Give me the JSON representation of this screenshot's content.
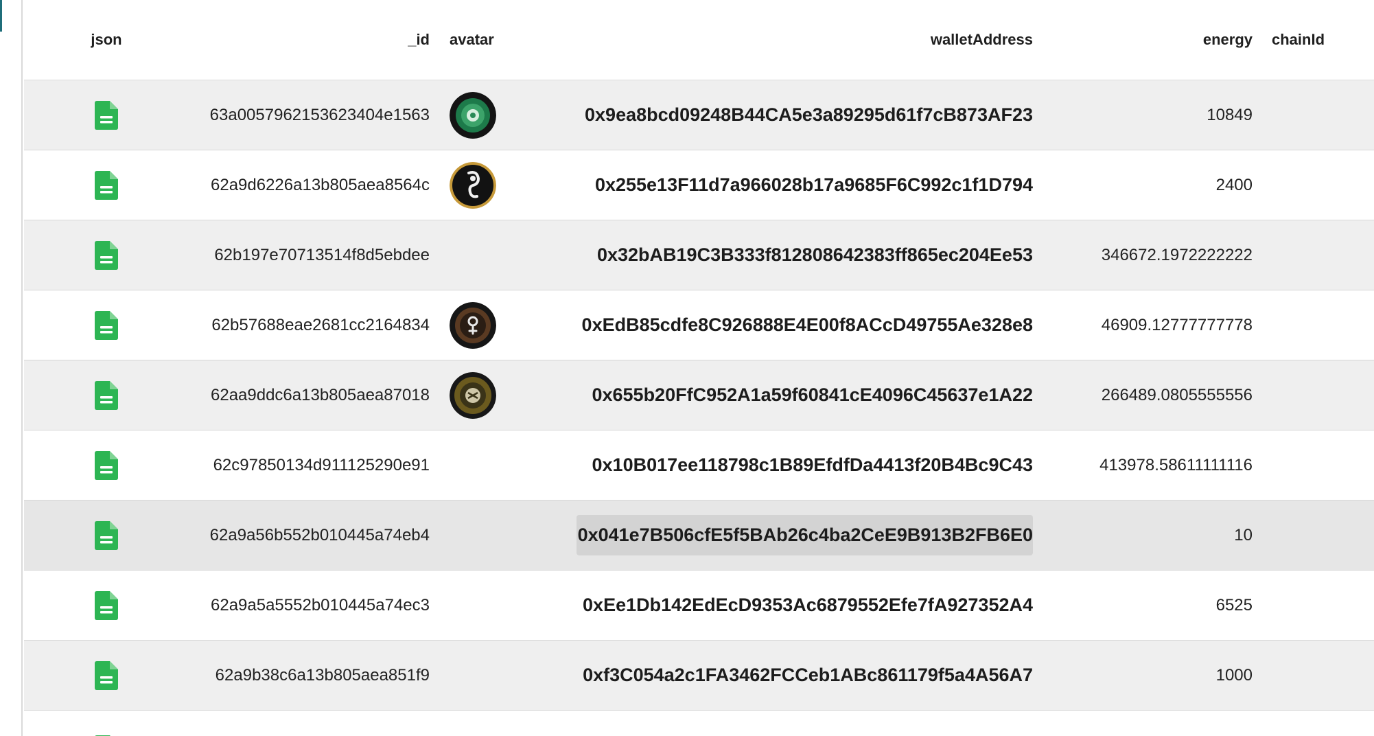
{
  "colors": {
    "accent": "#1f6e7a",
    "json_icon": "#2db553",
    "row_striped": "#efefef",
    "row_plain": "#ffffff",
    "selected_cell": "#d3d3d3"
  },
  "columns": {
    "json": "json",
    "id": "_id",
    "avatar": "avatar",
    "wallet": "walletAddress",
    "energy": "energy",
    "chain": "chainId"
  },
  "rows": [
    {
      "id": "63a0057962153623404e1563",
      "wallet": "0x9ea8bcd09248B44CA5e3a89295d61f7cB873AF23",
      "energy": "10849",
      "chain": "",
      "avatar": "green-orb-avatar"
    },
    {
      "id": "62a9d6226a13b805aea8564c",
      "wallet": "0x255e13F11d7a966028b17a9685F6C992c1f1D794",
      "energy": "2400",
      "chain": "",
      "avatar": "gold-rim-glyph-avatar"
    },
    {
      "id": "62b197e70713514f8d5ebdee",
      "wallet": "0x32bAB19C3B333f812808642383ff865ec204Ee53",
      "energy": "346672.1972222222",
      "chain": "",
      "avatar": ""
    },
    {
      "id": "62b57688eae2681cc2164834",
      "wallet": "0xEdB85cdfe8C926888E4E00f8ACcD49755Ae328e8",
      "energy": "46909.12777777778",
      "chain": "",
      "avatar": "bronze-ring-avatar"
    },
    {
      "id": "62aa9ddc6a13b805aea87018",
      "wallet": "0x655b20FfC952A1a59f60841cE4096C45637e1A22",
      "energy": "266489.0805555556",
      "chain": "",
      "avatar": "olive-emblem-avatar"
    },
    {
      "id": "62c97850134d911125290e91",
      "wallet": "0x10B017ee118798c1B89EfdfDa4413f20B4Bc9C43",
      "energy": "413978.58611111116",
      "chain": "",
      "avatar": ""
    },
    {
      "id": "62a9a56b552b010445a74eb4",
      "wallet": "0x041e7B506cfE5f5BAb26c4ba2CeE9B913B2FB6E0",
      "energy": "10",
      "chain": "",
      "avatar": ""
    },
    {
      "id": "62a9a5a5552b010445a74ec3",
      "wallet": "0xEe1Db142EdEcD9353Ac6879552Efe7fA927352A4",
      "energy": "6525",
      "chain": "",
      "avatar": ""
    },
    {
      "id": "62a9b38c6a13b805aea851f9",
      "wallet": "0xf3C054a2c1FA3462FCCeb1ABc861179f5a4A56A7",
      "energy": "1000",
      "chain": "",
      "avatar": ""
    }
  ]
}
